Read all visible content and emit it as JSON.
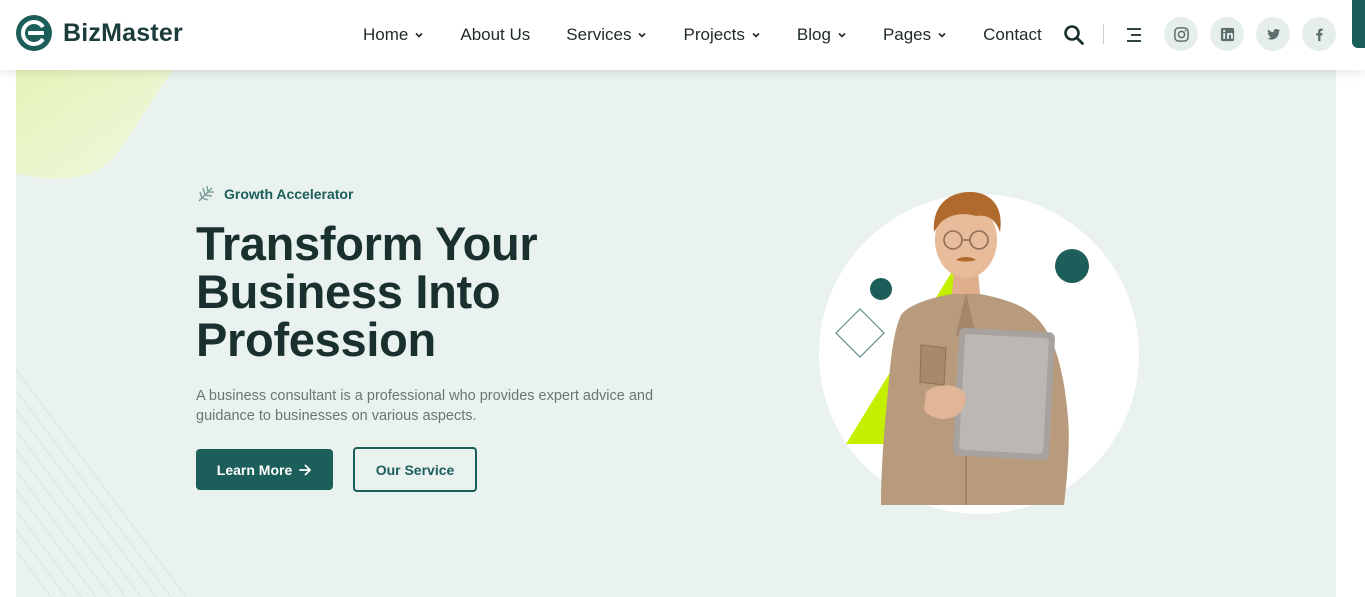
{
  "brand": {
    "name": "BizMaster",
    "primary_color": "#1b5e5a",
    "accent_color": "#c4f000",
    "hero_bg": "#e9f2ee"
  },
  "nav": {
    "items": [
      {
        "label": "Home",
        "has_dropdown": true
      },
      {
        "label": "About Us",
        "has_dropdown": false
      },
      {
        "label": "Services",
        "has_dropdown": true
      },
      {
        "label": "Projects",
        "has_dropdown": true
      },
      {
        "label": "Blog",
        "has_dropdown": true
      },
      {
        "label": "Pages",
        "has_dropdown": true
      },
      {
        "label": "Contact",
        "has_dropdown": false
      }
    ],
    "icons": [
      "search-icon",
      "menu-icon"
    ],
    "social": [
      "instagram-icon",
      "linkedin-icon",
      "twitter-icon",
      "facebook-icon"
    ]
  },
  "hero": {
    "eyebrow": "Growth Accelerator",
    "headline": [
      "Transform Your",
      "Business Into",
      "Profession"
    ],
    "description": "A business consultant is a professional who provides expert advice and guidance to businesses on various aspects.",
    "primary_button": "Learn More",
    "secondary_button": "Our Service"
  }
}
